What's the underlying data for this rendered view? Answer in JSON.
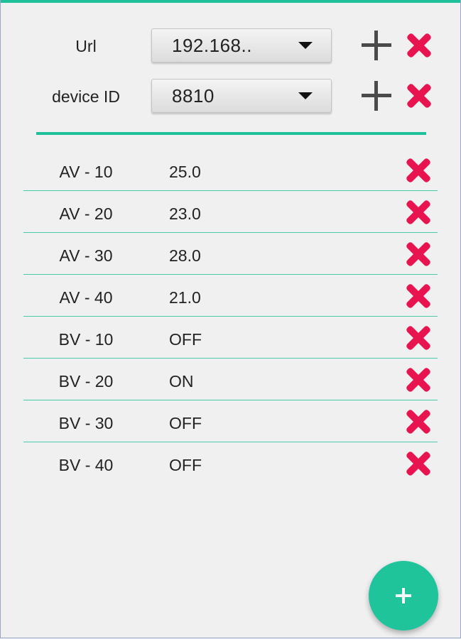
{
  "config": {
    "url": {
      "label": "Url",
      "value": "192.168.."
    },
    "device": {
      "label": "device ID",
      "value": "8810"
    }
  },
  "points": [
    {
      "name": "AV - 10",
      "value": "25.0"
    },
    {
      "name": "AV - 20",
      "value": "23.0"
    },
    {
      "name": "AV - 30",
      "value": "28.0"
    },
    {
      "name": "AV - 40",
      "value": "21.0"
    },
    {
      "name": "BV - 10",
      "value": "OFF"
    },
    {
      "name": "BV - 20",
      "value": "ON"
    },
    {
      "name": "BV - 30",
      "value": "OFF"
    },
    {
      "name": "BV - 40",
      "value": "OFF"
    }
  ],
  "colors": {
    "accent": "#1fbf9a",
    "delete": "#e8144f",
    "add_icon": "#4a4a4a",
    "background": "#f0f0f0"
  },
  "icons": {
    "add": "plus-icon",
    "delete": "close-x-icon",
    "dropdown": "chevron-down-icon"
  }
}
